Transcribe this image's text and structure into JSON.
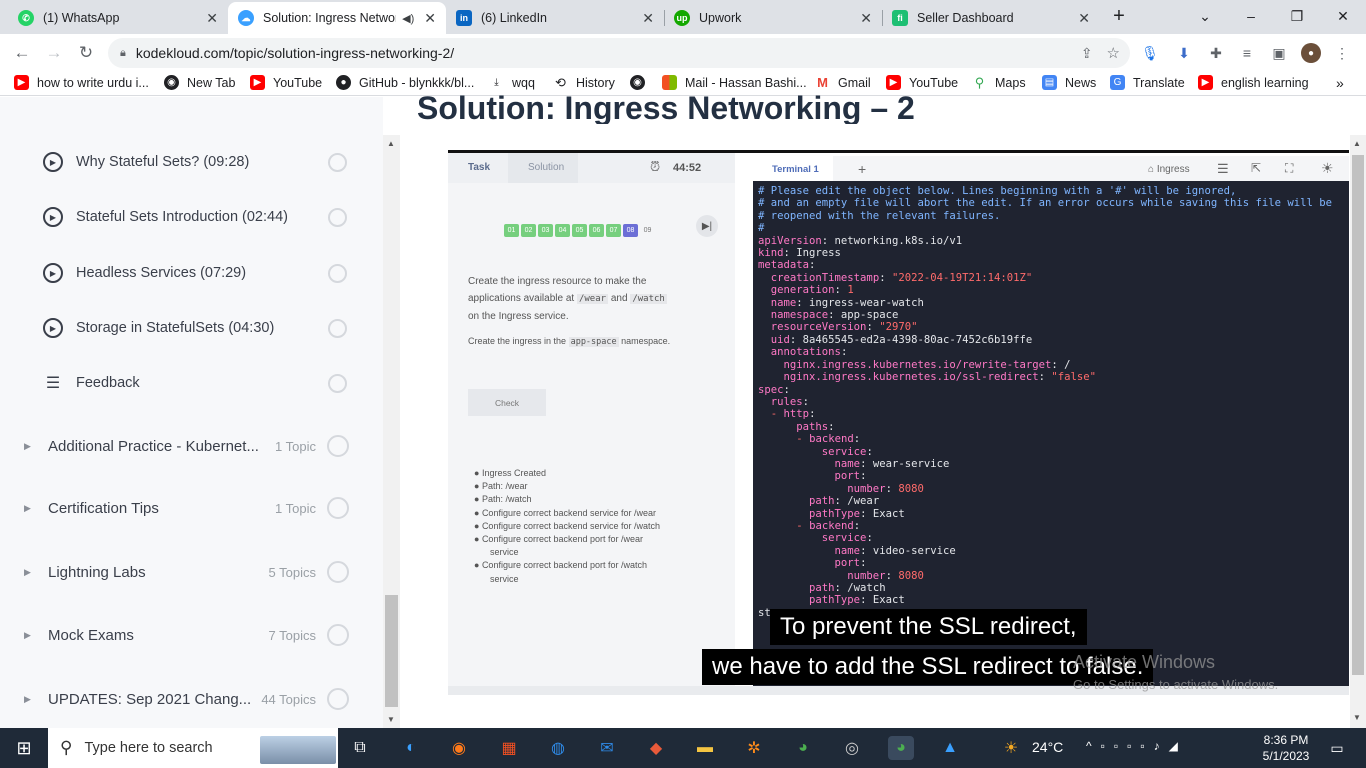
{
  "tabs": [
    {
      "label": "(1) WhatsApp",
      "icon": "whatsapp-icon",
      "color": "#25d366"
    },
    {
      "label": "Solution: Ingress Networ",
      "icon": "kodekloud-icon",
      "color": "#3aa0ff",
      "active": true
    },
    {
      "label": "(6) LinkedIn",
      "icon": "linkedin-icon",
      "color": "#0a66c2"
    },
    {
      "label": "Upwork",
      "icon": "upwork-icon",
      "color": "#14a800"
    },
    {
      "label": "Seller Dashboard",
      "icon": "fiverr-icon",
      "color": "#1dbf73"
    }
  ],
  "window_controls": {
    "minimize": "–",
    "restore": "❐",
    "close": "✕",
    "newtab": "+",
    "dropdown": "⌄"
  },
  "url": "kodekloud.com/topic/solution-ingress-networking-2/",
  "bookmarks": [
    {
      "label": "how to write urdu i...",
      "icon": "youtube-icon",
      "color": "#ff0000"
    },
    {
      "label": "New Tab",
      "icon": "globe-icon",
      "color": "#202124"
    },
    {
      "label": "YouTube",
      "icon": "youtube-icon",
      "color": "#ff0000"
    },
    {
      "label": "GitHub - blynkkk/bl...",
      "icon": "github-icon",
      "color": "#202124"
    },
    {
      "label": "wqq",
      "icon": "download-icon",
      "color": "#202124"
    },
    {
      "label": "History",
      "icon": "history-icon",
      "color": "#202124"
    },
    {
      "label": "",
      "icon": "globe-icon",
      "color": "#202124"
    },
    {
      "label": "Mail - Hassan Bashi...",
      "icon": "microsoft-icon",
      "color": "#f25022"
    },
    {
      "label": "Gmail",
      "icon": "gmail-icon",
      "color": "#ea4335"
    },
    {
      "label": "YouTube",
      "icon": "youtube-icon",
      "color": "#ff0000"
    },
    {
      "label": "Maps",
      "icon": "maps-icon",
      "color": "#34a853"
    },
    {
      "label": "News",
      "icon": "news-icon",
      "color": "#4285f4"
    },
    {
      "label": "Translate",
      "icon": "translate-icon",
      "color": "#4285f4"
    },
    {
      "label": "english learning",
      "icon": "youtube-icon",
      "color": "#ff0000"
    }
  ],
  "sidebar": {
    "lessons": [
      {
        "label": "Why Stateful Sets? (09:28)"
      },
      {
        "label": "Stateful Sets Introduction (02:44)"
      },
      {
        "label": "Headless Services (07:29)"
      },
      {
        "label": "Storage in StatefulSets (04:30)"
      },
      {
        "label": "Feedback"
      }
    ],
    "topics": [
      {
        "label": "Additional Practice - Kubernet...",
        "count": "1 Topic"
      },
      {
        "label": "Certification Tips",
        "count": "1 Topic"
      },
      {
        "label": "Lightning Labs",
        "count": "5 Topics"
      },
      {
        "label": "Mock Exams",
        "count": "7 Topics"
      },
      {
        "label": "UPDATES: Sep 2021 Chang...",
        "count": "44 Topics"
      }
    ]
  },
  "page_title": "Solution: Ingress Networking – 2",
  "lab": {
    "tab_task": "Task",
    "tab_solution": "Solution",
    "timer": "44:52",
    "steps": [
      "01",
      "02",
      "03",
      "04",
      "05",
      "06",
      "07",
      "08",
      "09"
    ],
    "task_text_1": "Create the ingress resource to make the",
    "task_text_2": "applications available at",
    "path_wear": "/wear",
    "and": "and",
    "path_watch": "/watch",
    "task_text_3": "on the Ingress service.",
    "task_text_4": "Create the ingress in the",
    "ns": "app-space",
    "ns_suffix": "namespace.",
    "check": "Check",
    "checks": [
      "Ingress Created",
      "Path: /wear",
      "Path: /watch",
      "Configure correct backend service for /wear",
      "Configure correct backend service for /watch",
      "Configure correct backend port for /wear",
      "service",
      "Configure correct backend port for /watch",
      "service"
    ],
    "terminal_tab": "Terminal 1",
    "terminal_plus": "+",
    "ingress_label": "Ingress"
  },
  "captions": {
    "line1": "To prevent the SSL redirect,",
    "line2": "we have to add the SSL redirect to false."
  },
  "watermark": {
    "line1": "Activate Windows",
    "line2": "Go to Settings to activate Windows."
  },
  "taskbar": {
    "search": "Type here to search",
    "temp": "24°C",
    "time": "8:36 PM",
    "date": "5/1/2023"
  }
}
